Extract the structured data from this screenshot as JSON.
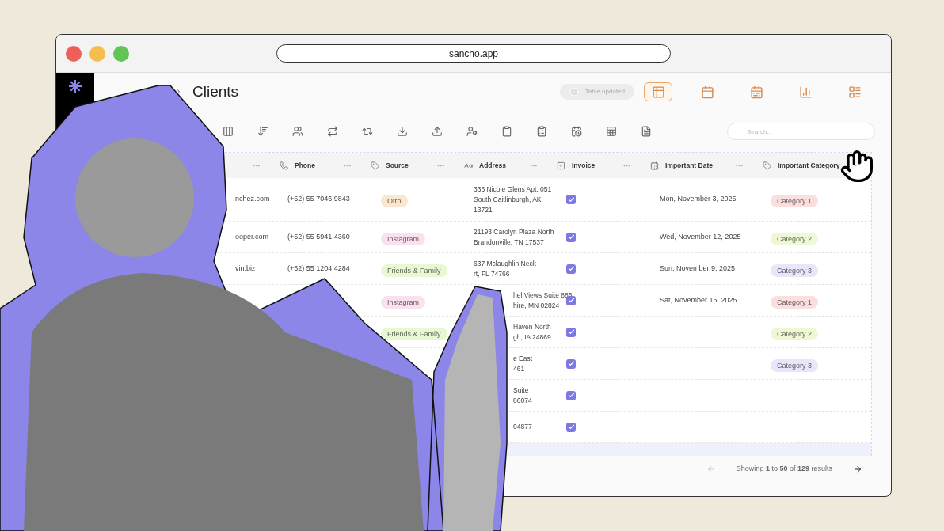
{
  "browser": {
    "url": "sancho.app"
  },
  "page": {
    "title": "Clients"
  },
  "status_pill": {
    "label": "Table updated"
  },
  "views": [
    {
      "kind": "table",
      "selected": true
    },
    {
      "kind": "calendar",
      "selected": false
    },
    {
      "kind": "week",
      "selected": false
    },
    {
      "kind": "chart",
      "selected": false
    },
    {
      "kind": "gantt",
      "selected": false
    }
  ],
  "search": {
    "placeholder": "Search..."
  },
  "table": {
    "columns": [
      {
        "kind": "email"
      },
      {
        "kind": "phone",
        "label": "Phone"
      },
      {
        "kind": "tag",
        "label": "Source"
      },
      {
        "kind": "text",
        "label": "Address"
      },
      {
        "kind": "check",
        "label": "Invoice"
      },
      {
        "kind": "date",
        "label": "Important Date"
      },
      {
        "kind": "tag",
        "label": "Important Category"
      }
    ],
    "rows": [
      {
        "email": "nchez.com",
        "phone": "(+52) 55 7046 9843",
        "source": {
          "label": "Otro",
          "color": "#fbe6cf"
        },
        "address": [
          "336 Nicole Glens Apt. 051",
          "South Caitlinburgh, AK",
          "13721"
        ],
        "invoice": true,
        "date": "Mon, November 3, 2025",
        "category": {
          "label": "Category 1",
          "color": "#fbdfdf"
        }
      },
      {
        "email": "ooper.com",
        "phone": "(+52) 55 5941 4360",
        "source": {
          "label": "Instagram",
          "color": "#fbe1ee"
        },
        "address": [
          "21193 Carolyn Plaza North",
          "Brandonville, TN 17537"
        ],
        "invoice": true,
        "date": "Wed, November 12, 2025",
        "category": {
          "label": "Category 2",
          "color": "#eef8d4"
        }
      },
      {
        "email": "vin.biz",
        "phone": "(+52) 55 1204 4284",
        "source": {
          "label": "Friends & Family",
          "color": "#e8f8d2"
        },
        "address": [
          "637 Mclaughlin Neck",
          "rt, FL 74766"
        ],
        "invoice": true,
        "date": "Sun, November 9, 2025",
        "category": {
          "label": "Category 3",
          "color": "#ebe5fb"
        }
      },
      {
        "source": {
          "label": "Instagram",
          "color": "#fbe1ee"
        },
        "address": [
          "hel Views Suite 885",
          "hire, MN 02824"
        ],
        "invoice": true,
        "date": "Sat, November 15, 2025",
        "category": {
          "label": "Category 1",
          "color": "#fbdfdf"
        }
      },
      {
        "source": {
          "label": "Friends & Family",
          "color": "#e8f8d2"
        },
        "address": [
          "Haven North",
          "gh, IA 24869"
        ],
        "invoice": true,
        "category": {
          "label": "Category 2",
          "color": "#eef8d4"
        }
      },
      {
        "address": [
          "e East",
          "461"
        ],
        "invoice": true,
        "category": {
          "label": "Category 3",
          "color": "#ebe5fb"
        }
      },
      {
        "address": [
          "Suite",
          "86074"
        ],
        "invoice": true
      },
      {
        "address": [
          "04877"
        ],
        "invoice": true
      }
    ]
  },
  "pagination": {
    "summary": "Showing **1** to **50** of **129** results",
    "prev_disabled": true
  }
}
